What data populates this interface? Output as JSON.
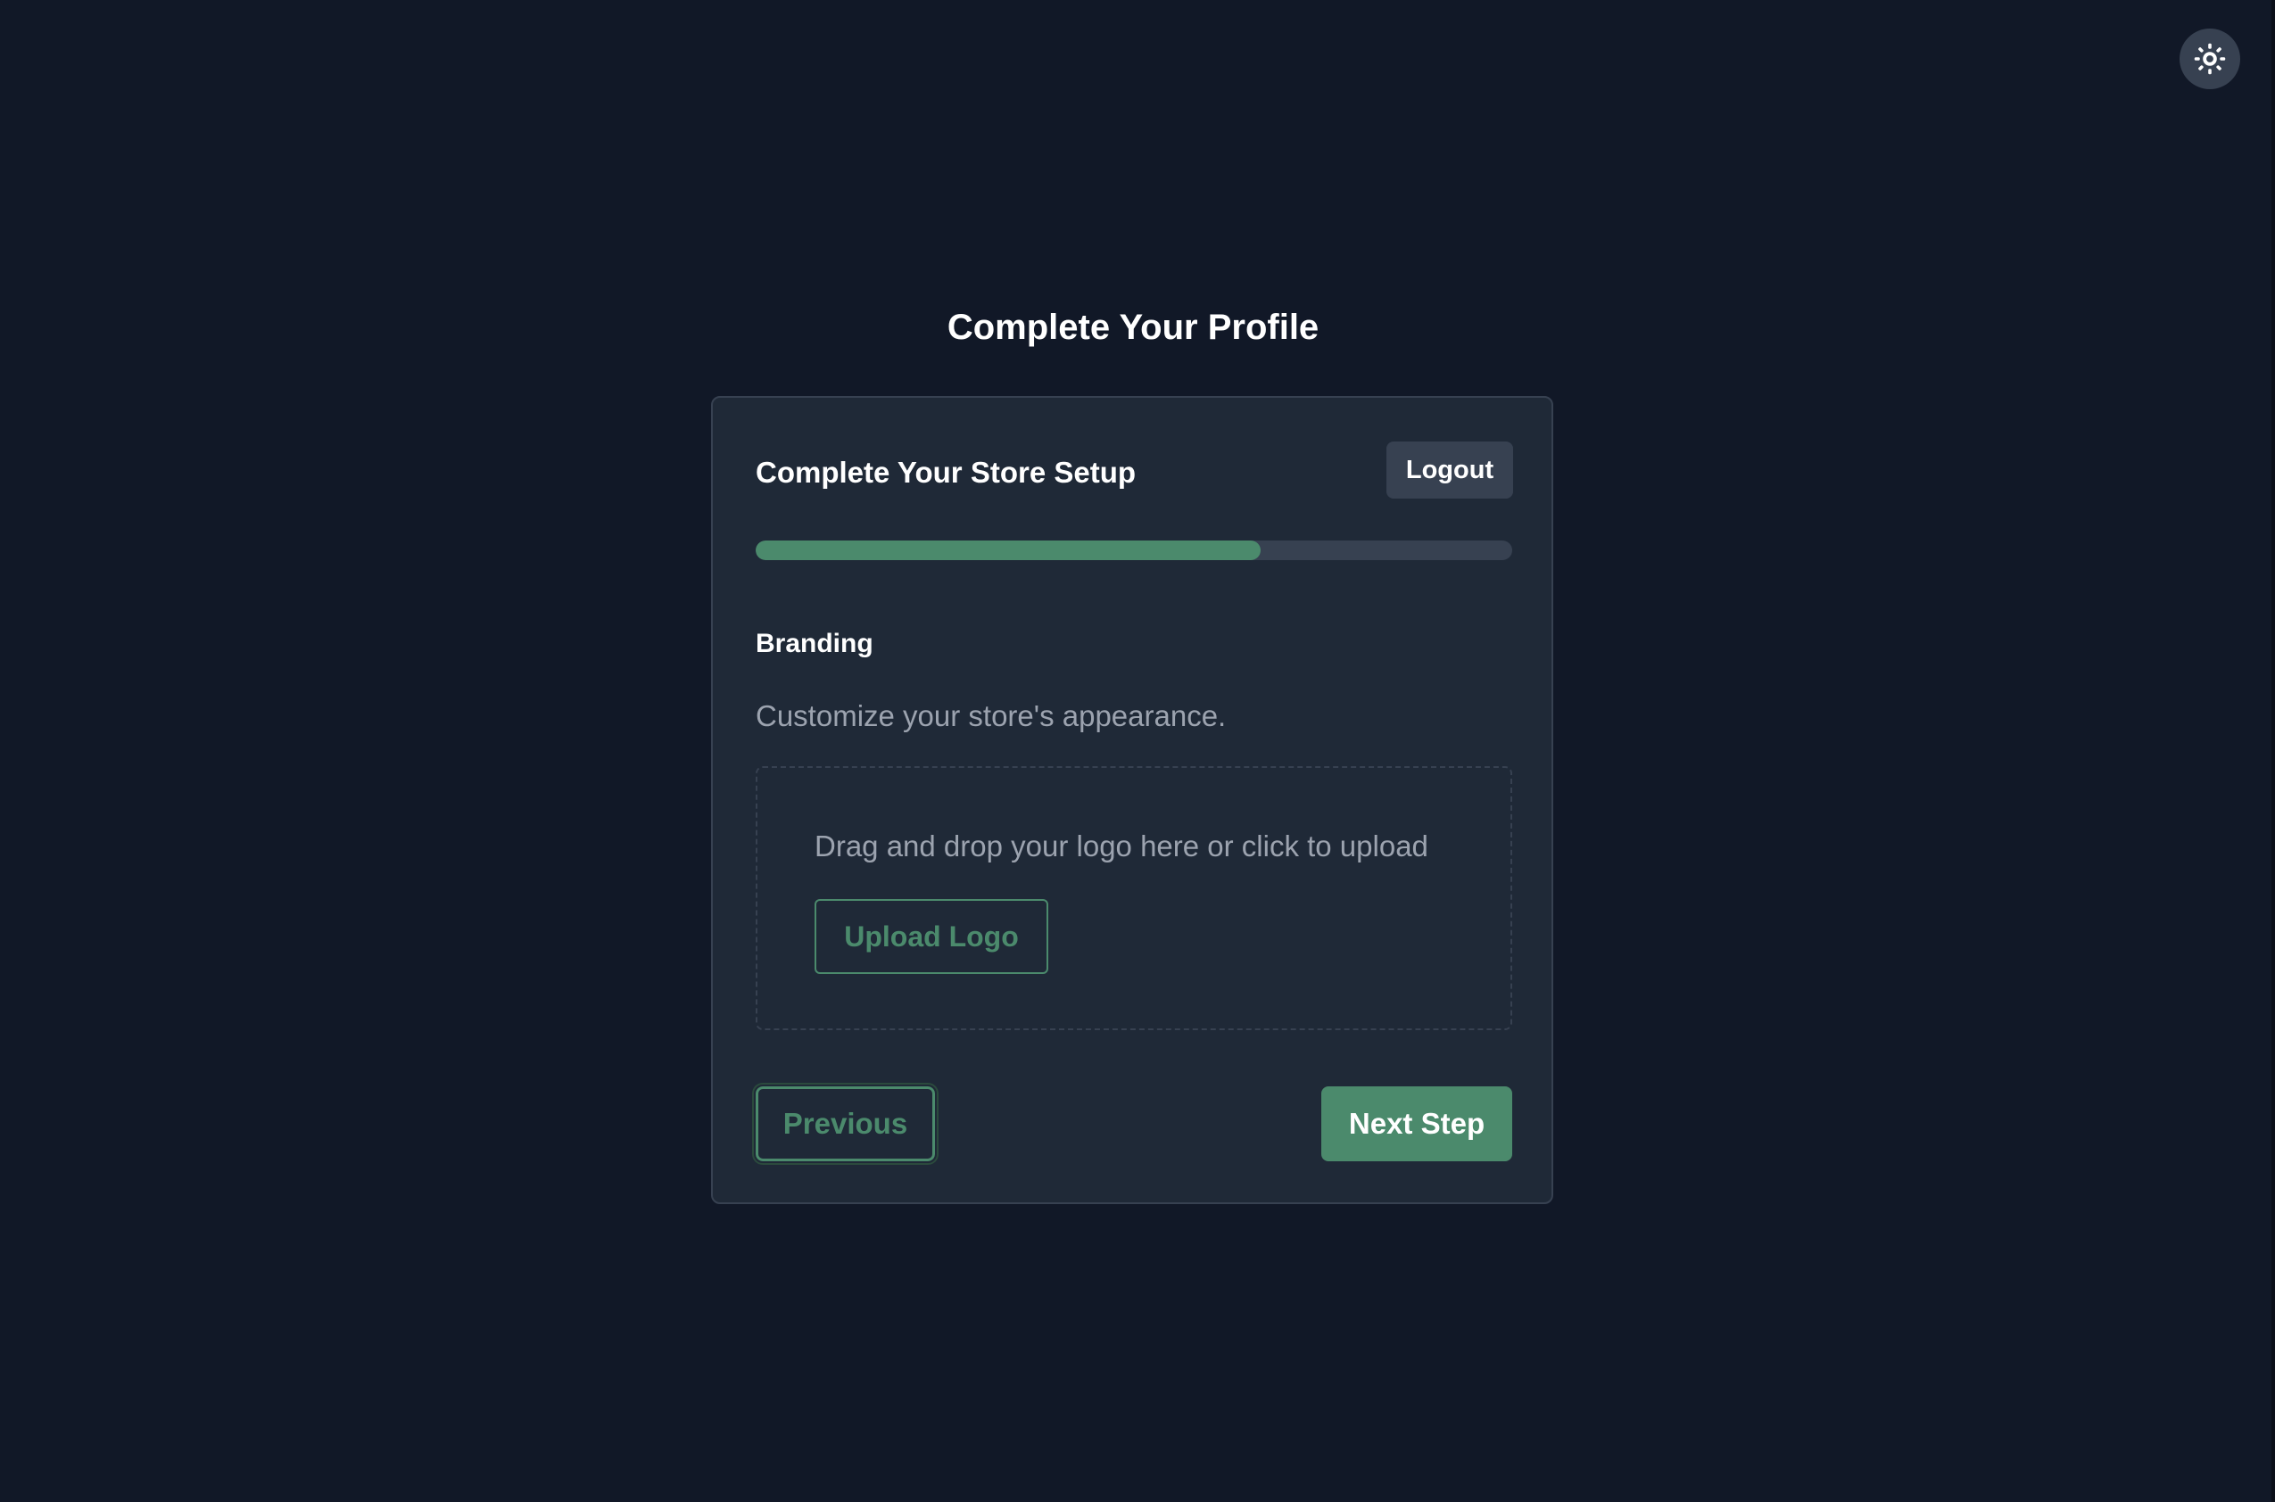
{
  "page": {
    "title": "Complete Your Profile"
  },
  "theme_toggle": {
    "icon": "sun-icon"
  },
  "card": {
    "title": "Complete Your Store Setup",
    "logout_label": "Logout",
    "progress": {
      "percent": 66.7
    },
    "step": {
      "label": "Branding",
      "description": "Customize your store's appearance."
    },
    "dropzone": {
      "text": "Drag and drop your logo here or click to upload",
      "button_label": "Upload Logo"
    },
    "previous_label": "Previous",
    "next_label": "Next Step"
  },
  "colors": {
    "background": "#111827",
    "card": "#1f2937",
    "accent": "#4b8a6c",
    "muted_text": "#9ca3af",
    "secondary_button": "#374151"
  }
}
